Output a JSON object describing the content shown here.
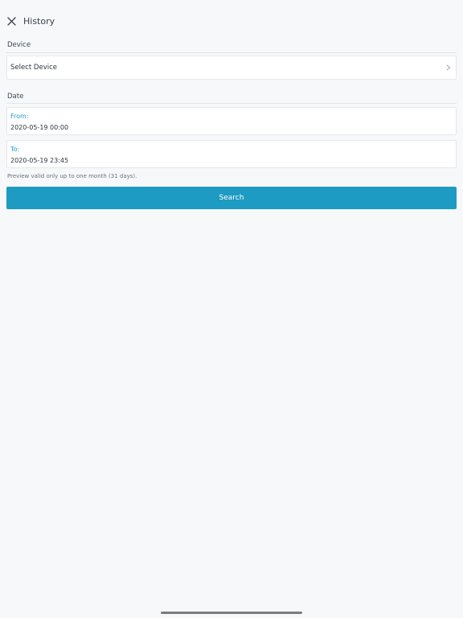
{
  "header": {
    "title": "History"
  },
  "device": {
    "section_label": "Device",
    "select_text": "Select Device"
  },
  "date": {
    "section_label": "Date",
    "from_label": "From:",
    "from_value": "2020-05-19 00:00",
    "to_label": "To:",
    "to_value": "2020-05-19 23:45",
    "note": "Preview valid only up to one month (31 days)."
  },
  "actions": {
    "search_label": "Search"
  },
  "colors": {
    "accent": "#1e9bc2",
    "label_accent": "#1d9ac4",
    "background": "#f6f8fa"
  },
  "icons": {
    "close": "close-icon",
    "chevron": "chevron-right-icon"
  }
}
